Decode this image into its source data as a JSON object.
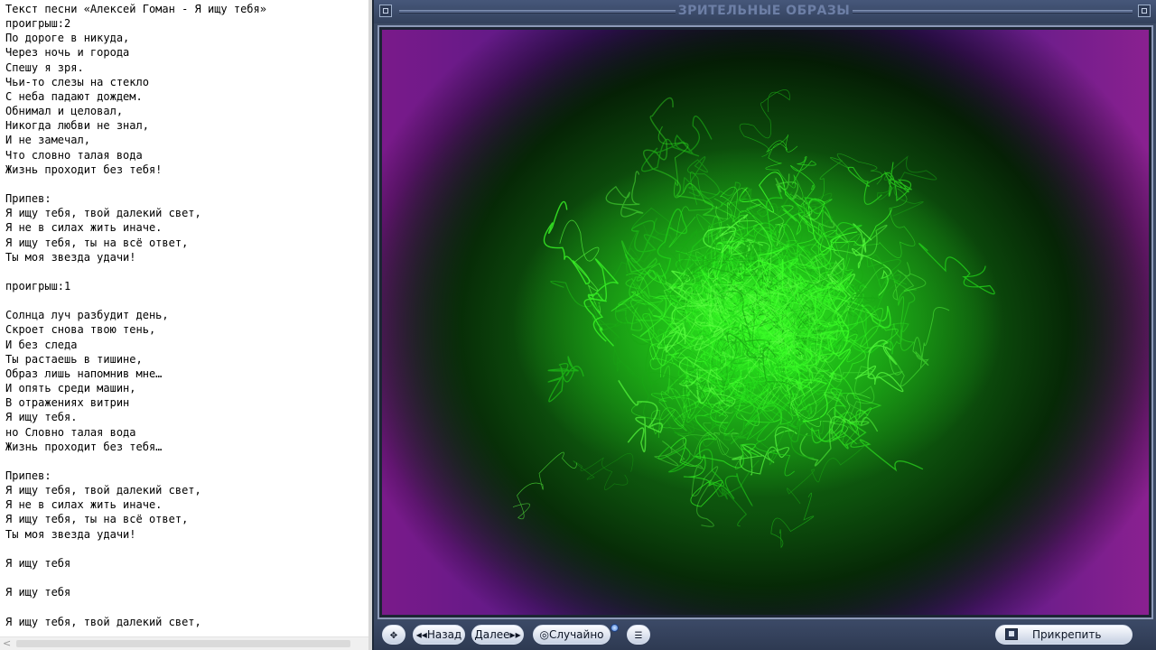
{
  "editor": {
    "lines": [
      "Текст песни «Алексей Гоман - Я ищу тебя»",
      "проигрыш:2",
      "По дороге в никуда,",
      "Через ночь и города",
      "Спешу я зря.",
      "Чьи-то слезы на стекло",
      "С неба падают дождем.",
      "Обнимал и целовал,",
      "Никогда любви не знал,",
      "И не замечал,",
      "Что словно талая вода",
      "Жизнь проходит без тебя!",
      "",
      "Припев:",
      "Я ищу тебя, твой далекий свет,",
      "Я не в силах жить иначе.",
      "Я ищу тебя, ты на всё ответ,",
      "Ты моя звезда удачи!",
      "",
      "проигрыш:1",
      "",
      "Солнца луч разбудит день,",
      "Скроет снова твою тень,",
      "И без следа",
      "Ты растаешь в тишине,",
      "Образ лишь напомнив мне…",
      "И опять среди машин,",
      "В отражениях витрин",
      "Я ищу тебя.",
      "но Словно талая вода",
      "Жизнь проходит без тебя…",
      "",
      "Припев:",
      "Я ищу тебя, твой далекий свет,",
      "Я не в силах жить иначе.",
      "Я ищу тебя, ты на всё ответ,",
      "Ты моя звезда удачи!",
      "",
      "Я ищу тебя",
      "",
      "Я ищу тебя",
      "",
      "Я ищу тебя, твой далекий свет,"
    ],
    "scroll_left_glyph": "<"
  },
  "window": {
    "title": "ЗРИТЕЛЬНЫЕ ОБРАЗЫ",
    "menu_icon": "window-menu-icon",
    "close_icon": "window-close-icon"
  },
  "controls": {
    "move_glyph": "✥",
    "prev_label": "◂◂Назад",
    "next_label": "Далее▸▸",
    "random_label": "◎Случайно",
    "list_glyph": "☰",
    "attach_label": "Прикрепить"
  },
  "colors": {
    "window_bg": "#3c4a64",
    "viz_green": "#3cff28",
    "viz_purple": "#7a1a8a"
  }
}
